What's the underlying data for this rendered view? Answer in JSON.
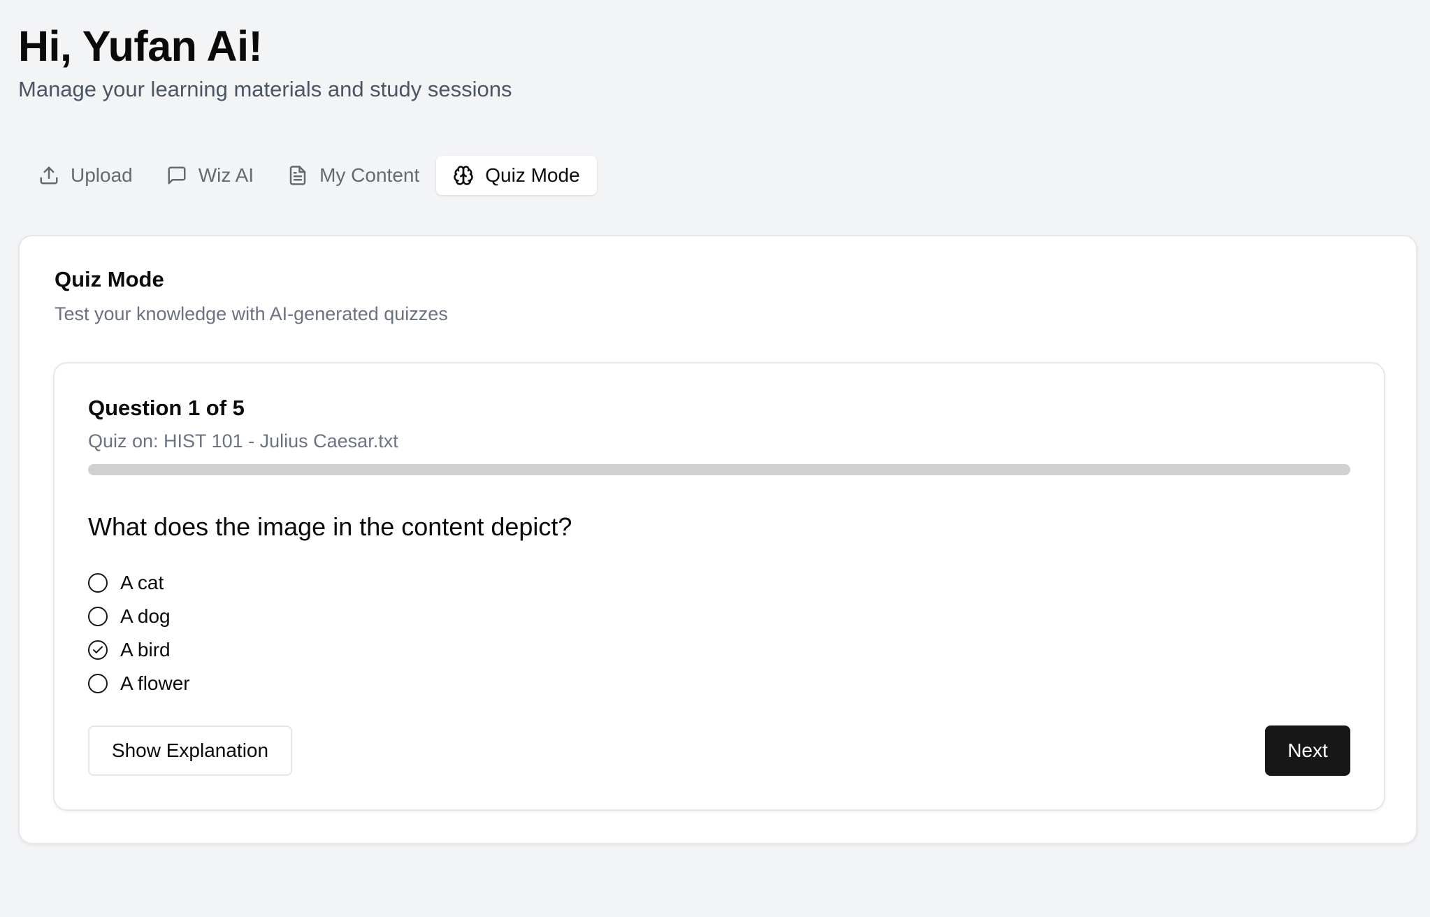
{
  "header": {
    "greeting": "Hi, Yufan Ai!",
    "subtitle": "Manage your learning materials and study sessions"
  },
  "tabs": [
    {
      "label": "Upload",
      "icon": "upload-icon",
      "active": false
    },
    {
      "label": "Wiz AI",
      "icon": "chat-bubble-icon",
      "active": false
    },
    {
      "label": "My Content",
      "icon": "document-icon",
      "active": false
    },
    {
      "label": "Quiz Mode",
      "icon": "brain-icon",
      "active": true
    }
  ],
  "card": {
    "title": "Quiz Mode",
    "description": "Test your knowledge with AI-generated quizzes"
  },
  "quiz": {
    "question_count": "Question 1 of 5",
    "source": "Quiz on: HIST 101 - Julius Caesar.txt",
    "progress": 0,
    "question": "What does the image in the content depict?",
    "options": [
      {
        "label": "A cat",
        "selected": false
      },
      {
        "label": "A dog",
        "selected": false
      },
      {
        "label": "A bird",
        "selected": true
      },
      {
        "label": "A flower",
        "selected": false
      }
    ],
    "explain_label": "Show Explanation",
    "next_label": "Next"
  },
  "colors": {
    "background": "#f3f4f6",
    "primary": "#171717",
    "muted_text": "#6b7280",
    "progress_track": "#d1d1d1"
  }
}
